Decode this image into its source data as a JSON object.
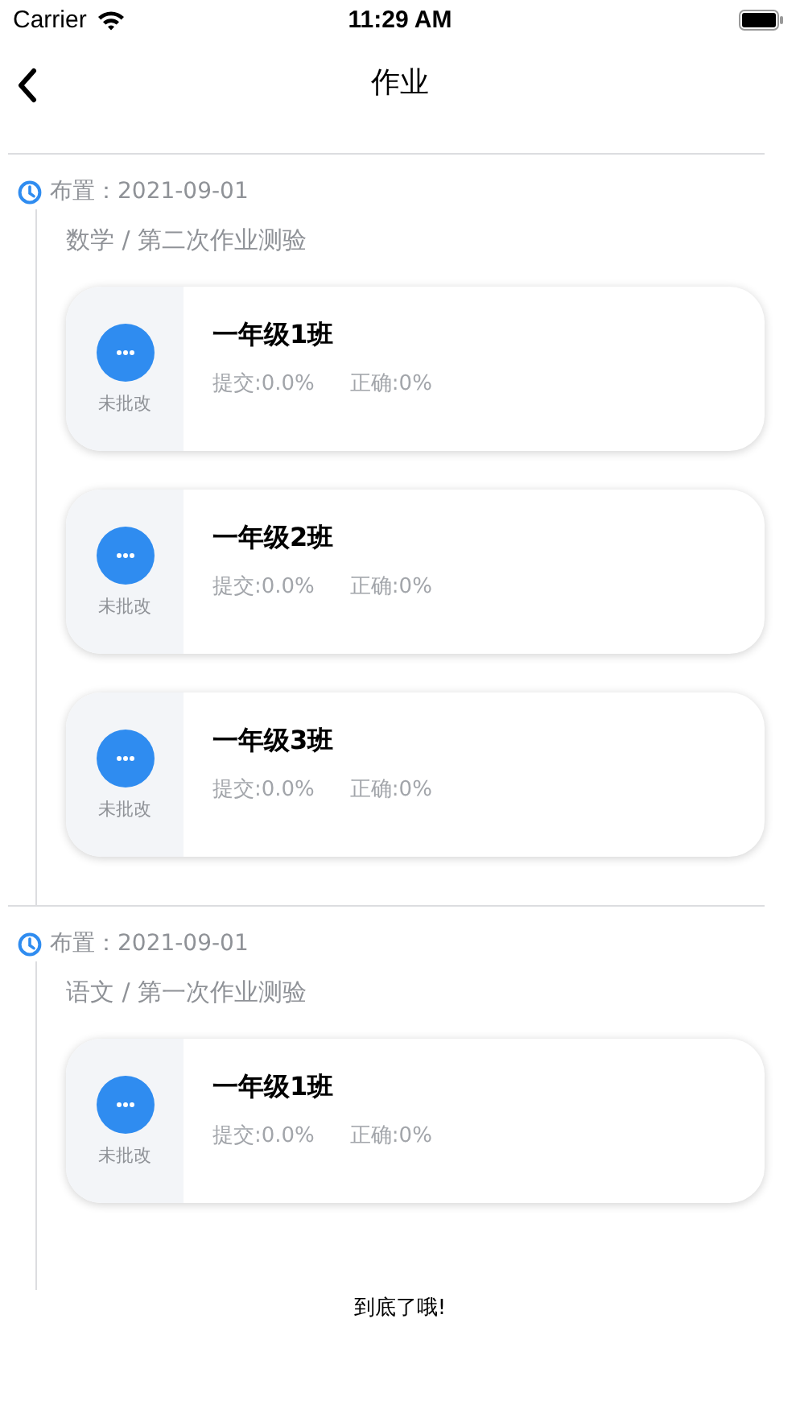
{
  "status_bar": {
    "carrier": "Carrier",
    "time": "11:29 AM"
  },
  "nav": {
    "title": "作业"
  },
  "sections": [
    {
      "assigned": "布置：2021-09-01",
      "subject": "数学 / 第二次作业测验",
      "cards": [
        {
          "status": "未批改",
          "class_name": "一年级1班",
          "submitted": "提交:0.0%",
          "correct": "正确:0%"
        },
        {
          "status": "未批改",
          "class_name": "一年级2班",
          "submitted": "提交:0.0%",
          "correct": "正确:0%"
        },
        {
          "status": "未批改",
          "class_name": "一年级3班",
          "submitted": "提交:0.0%",
          "correct": "正确:0%"
        }
      ]
    },
    {
      "assigned": "布置：2021-09-01",
      "subject": "语文 / 第一次作业测验",
      "cards": [
        {
          "status": "未批改",
          "class_name": "一年级1班",
          "submitted": "提交:0.0%",
          "correct": "正确:0%"
        }
      ]
    }
  ],
  "footer": "到底了哦!"
}
